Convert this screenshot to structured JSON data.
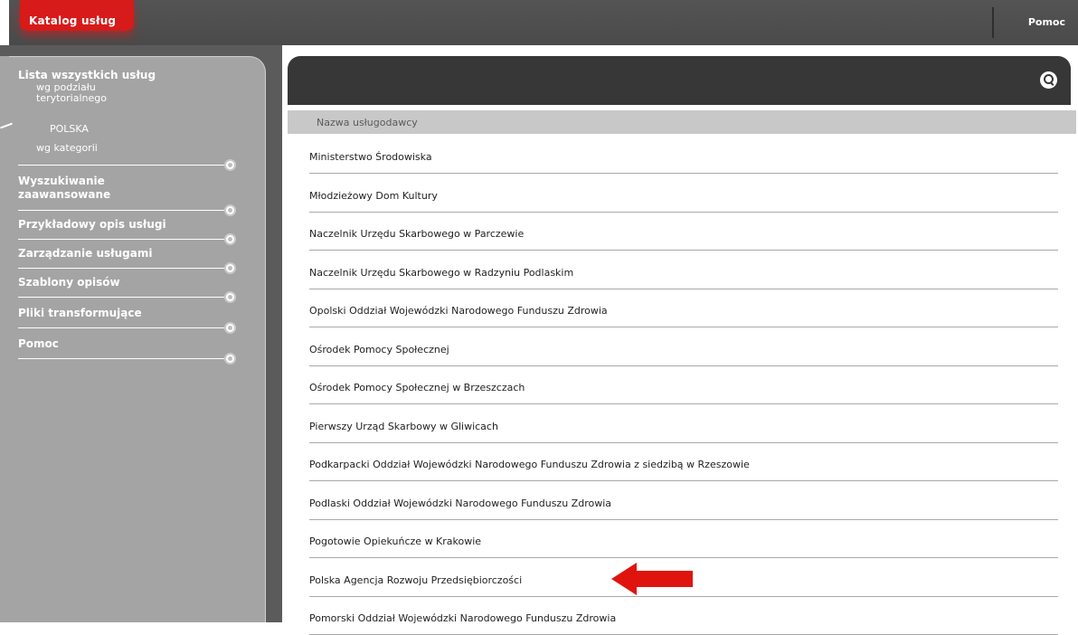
{
  "topbar": {
    "catalog_label": "Katalog usług",
    "help_label": "Pomoc"
  },
  "sidebar": {
    "all_services": "Lista wszystkich usług",
    "by_territory": "wg podziału terytorialnego",
    "poland": "POLSKA",
    "by_category": "wg kategorii",
    "advanced_search": "Wyszukiwanie zaawansowane",
    "sample_description": "Przykładowy opis usługi",
    "service_management": "Zarządzanie usługami",
    "templates": "Szablony opisów",
    "transform_files": "Pliki transformujące",
    "help": "Pomoc"
  },
  "main": {
    "search_icon": "search-icon",
    "column_header": "Nazwa usługodawcy",
    "providers": [
      "Ministerstwo Środowiska",
      "Młodzieżowy Dom Kultury",
      "Naczelnik Urzędu Skarbowego w Parczewie",
      "Naczelnik Urzędu Skarbowego w Radzyniu Podlaskim",
      "Opolski Oddział Wojewódzki Narodowego Funduszu Zdrowia",
      "Ośrodek Pomocy Społecznej",
      "Ośrodek Pomocy Społecznej w Brzeszczach",
      "Pierwszy Urząd Skarbowy w Gliwicach",
      "Podkarpacki Oddział Wojewódzki Narodowego Funduszu Zdrowia z siedzibą w Rzeszowie",
      "Podlaski Oddział Wojewódzki Narodowego Funduszu Zdrowia",
      "Pogotowie Opiekuńcze w Krakowie",
      "Polska Agencja Rozwoju Przedsiębiorczości",
      "Pomorski Oddział Wojewódzki Narodowego Funduszu Zdrowia"
    ]
  },
  "colors": {
    "accent_red": "#d71a1a",
    "topbar": "#4a4a4a",
    "sidebar": "#a4a4a4",
    "header_dark": "#373737"
  }
}
